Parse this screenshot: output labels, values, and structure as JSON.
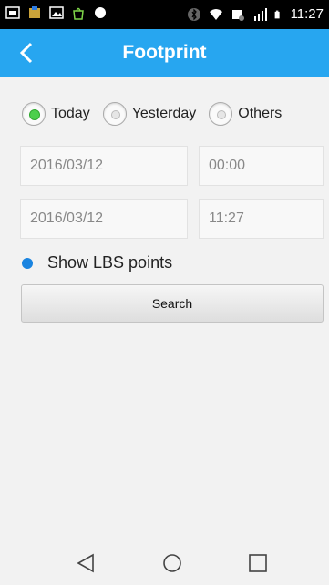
{
  "status_bar": {
    "time": "11:27",
    "icons": [
      "calendar-icon",
      "app-icon",
      "image-icon",
      "android-bag-icon",
      "record-dot-icon",
      "bluetooth-icon",
      "wifi-icon",
      "screenshot-icon",
      "signal-icon",
      "battery-icon"
    ]
  },
  "app_bar": {
    "title": "Footprint",
    "back_icon": "chevron-left-icon"
  },
  "date_range": {
    "options": [
      {
        "label": "Today",
        "selected": true
      },
      {
        "label": "Yesterday",
        "selected": false
      },
      {
        "label": "Others",
        "selected": false
      }
    ]
  },
  "start": {
    "date": "2016/03/12",
    "time": "00:00"
  },
  "end": {
    "date": "2016/03/12",
    "time": "11:27"
  },
  "lbs": {
    "label": "Show LBS points",
    "checked": true
  },
  "search_button": {
    "label": "Search"
  },
  "nav_bar": {
    "items": [
      "back-triangle-icon",
      "home-circle-icon",
      "recents-square-icon"
    ]
  },
  "colors": {
    "app_bar": "#27a6f0",
    "selected_radio": "#4ccf4c",
    "lbs_dot": "#1a84e0"
  }
}
